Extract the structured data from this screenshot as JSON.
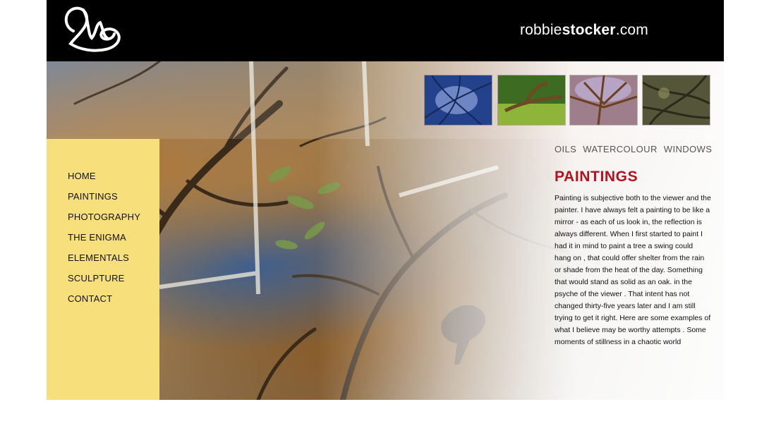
{
  "header": {
    "site_title_light": "robbie",
    "site_title_bold": "stocker",
    "site_title_suffix": ".com"
  },
  "thumbnails": [
    {
      "icon": "blue-tree-painting-thumbnail"
    },
    {
      "icon": "green-tree-painting-thumbnail"
    },
    {
      "icon": "tree-canopy-painting-thumbnail"
    },
    {
      "icon": "olive-branches-painting-thumbnail"
    }
  ],
  "nav": {
    "items": [
      "HOME",
      "PAINTINGS",
      "PHOTOGRAPHY",
      "THE ENIGMA",
      "ELEMENTALS",
      "SCULPTURE",
      "CONTACT"
    ]
  },
  "subnav": {
    "items": [
      "OILS",
      "WATERCOLOUR",
      "WINDOWS"
    ]
  },
  "content": {
    "heading": "PAINTINGS",
    "body": "Painting is subjective both to the viewer and the painter. I have always felt a painting to be like a mirror - as each of us look in, the reflection is always different. When I first started to paint I had it in mind to paint a tree a swing could hang on , that could offer shelter from the rain or shade from the heat of the day. Something that would stand as solid as an oak. in the psyche of the viewer . That intent has not changed thirty-five years later and I am still trying to get it right. Here are some examples of what I believe may be worthy attempts . Some moments of stillness in a chaotic world"
  },
  "colors": {
    "header_bg": "#000000",
    "nav_bg": "#f7e07c",
    "heading": "#b3141c"
  }
}
